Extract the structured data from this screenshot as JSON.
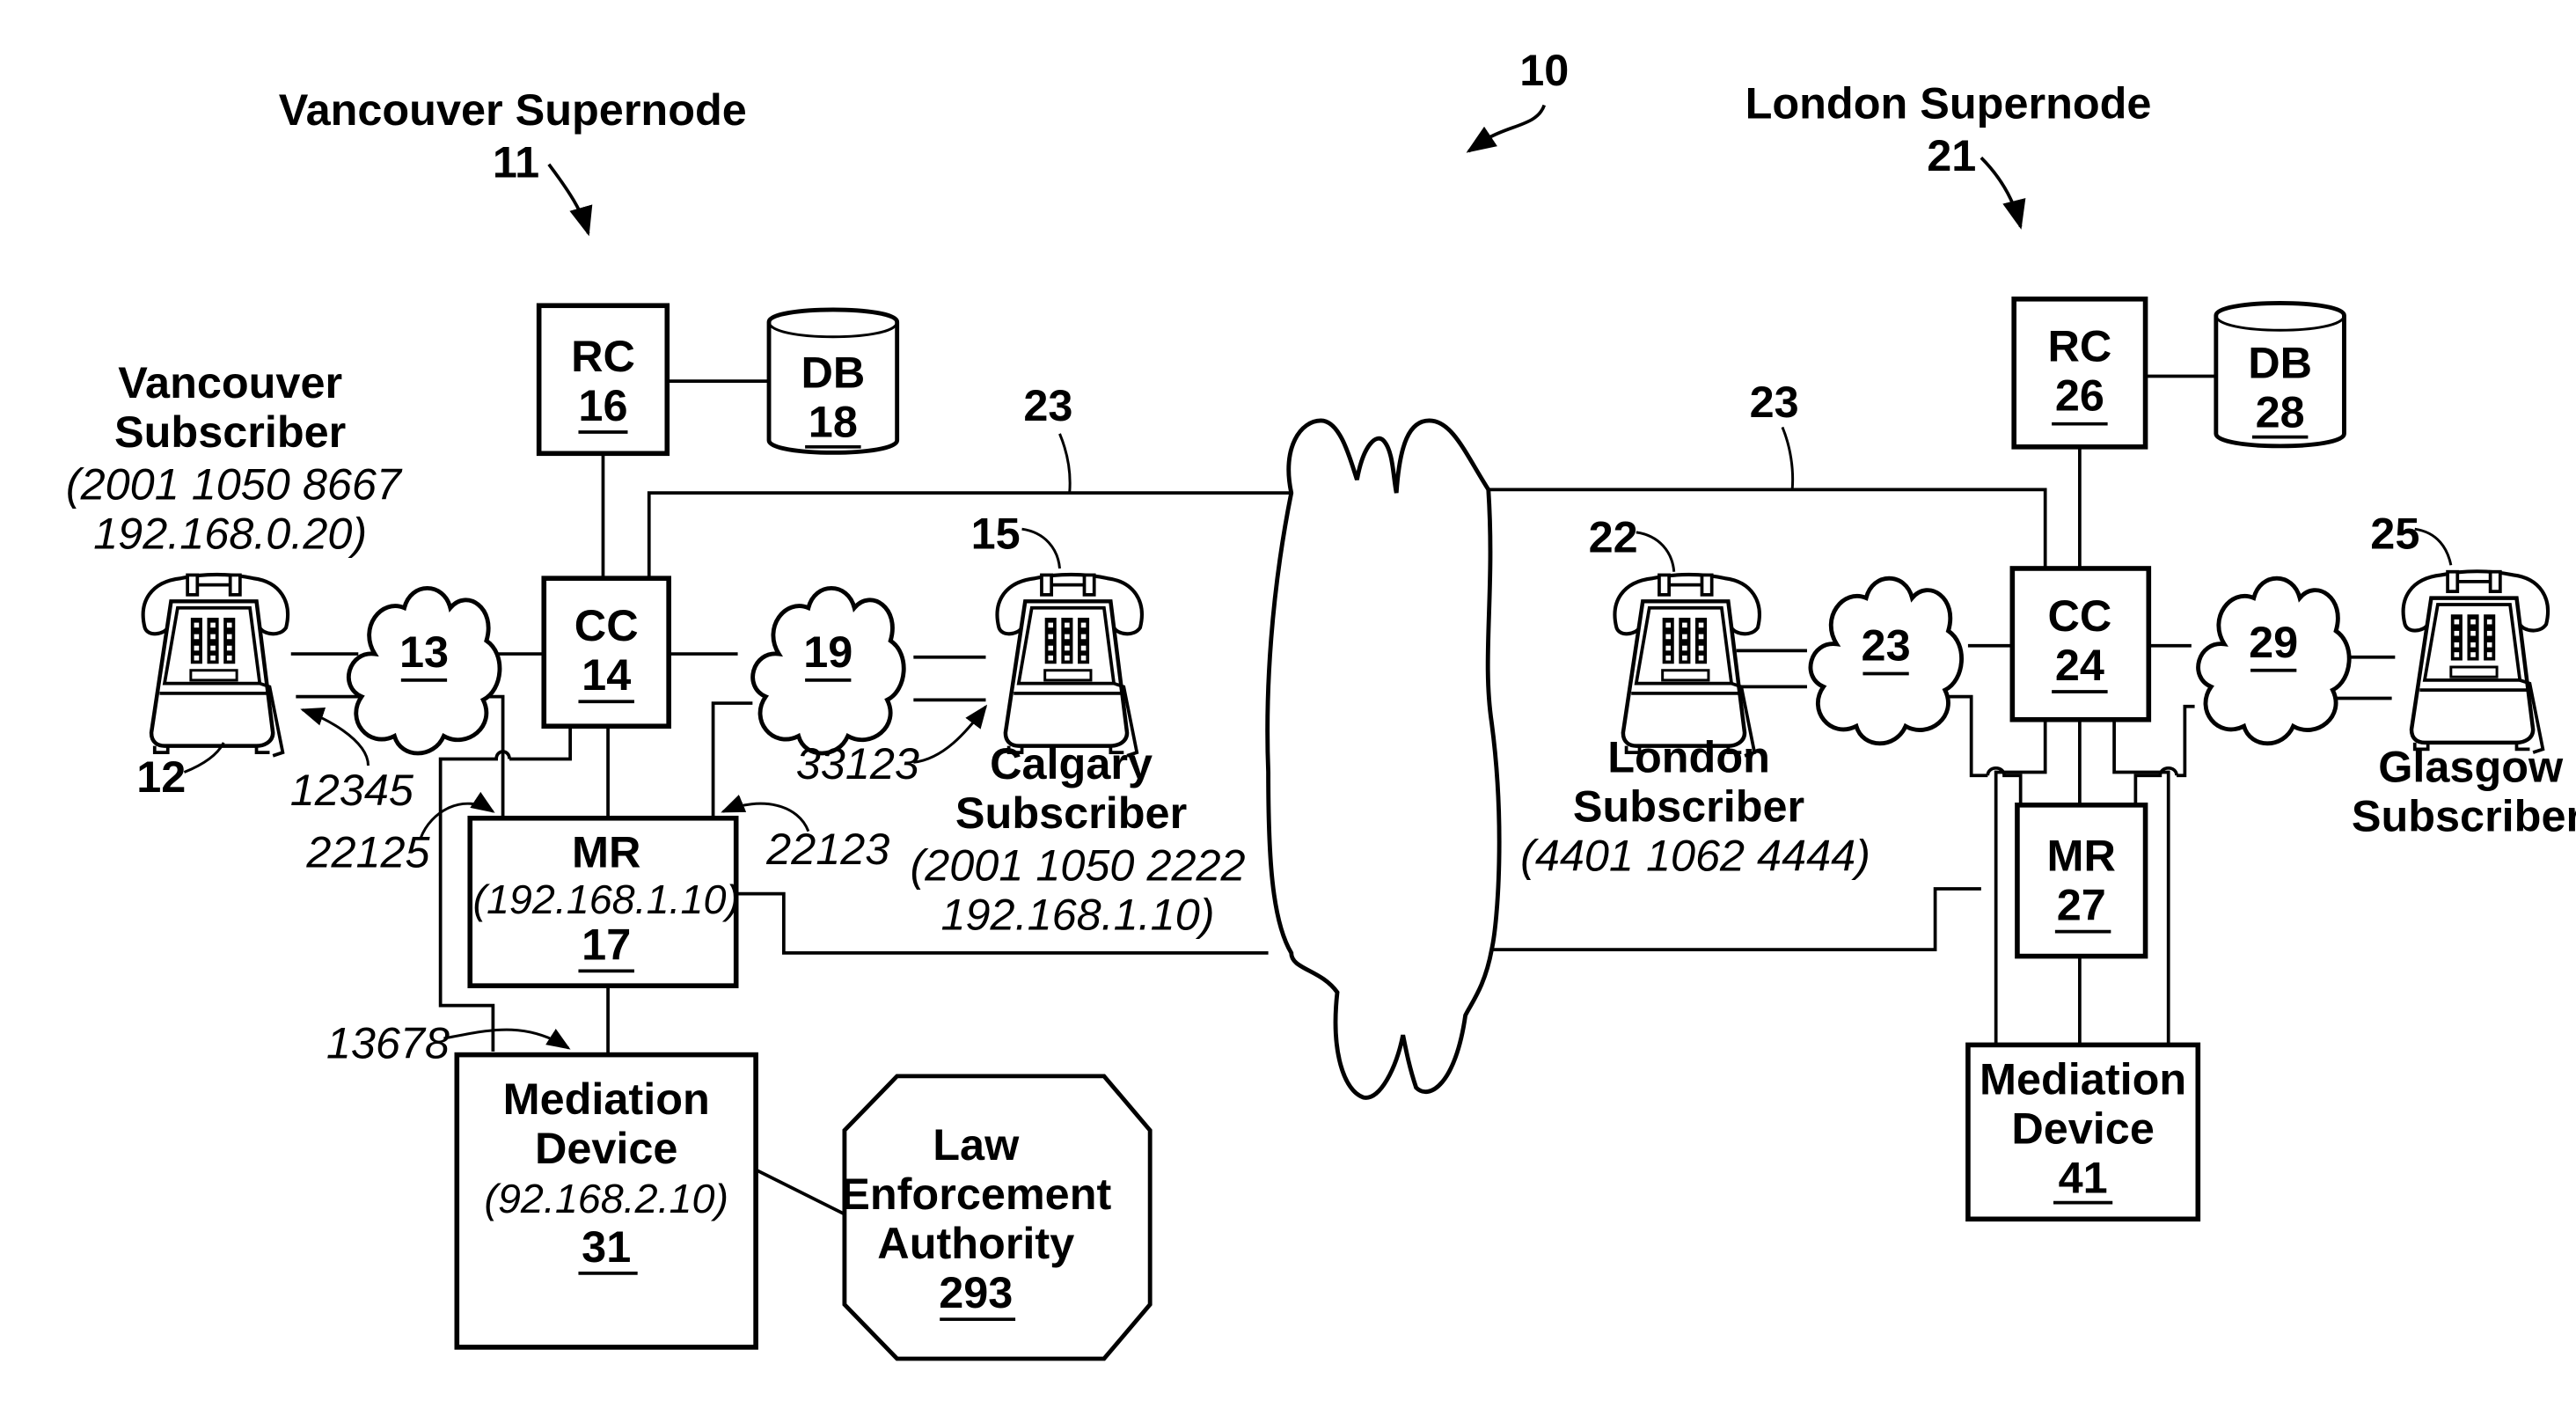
{
  "figure": {
    "ref": "10",
    "ink_color": "#000000",
    "background": "#ffffff"
  },
  "supernodes": {
    "vancouver": {
      "title": "Vancouver Supernode",
      "ref": "11"
    },
    "london": {
      "title": "London Supernode",
      "ref": "21"
    }
  },
  "nodes": {
    "rc16": {
      "name": "RC",
      "ref": "16"
    },
    "db18": {
      "name": "DB",
      "ref": "18"
    },
    "cc14": {
      "name": "CC",
      "ref": "14"
    },
    "mr17": {
      "name": "MR",
      "address": "(192.168.1.10)",
      "ref": "17"
    },
    "md31": {
      "name_line1": "Mediation",
      "name_line2": "Device",
      "address": "(92.168.2.10)",
      "ref": "31"
    },
    "lea293": {
      "line1": "Law",
      "line2": "Enforcement",
      "line3": "Authority",
      "ref": "293"
    },
    "rc26": {
      "name": "RC",
      "ref": "26"
    },
    "db28": {
      "name": "DB",
      "ref": "28"
    },
    "cc24": {
      "name": "CC",
      "ref": "24"
    },
    "mr27": {
      "name": "MR",
      "ref": "27"
    },
    "md41": {
      "name_line1": "Mediation",
      "name_line2": "Device",
      "ref": "41"
    }
  },
  "clouds": {
    "c13": "13",
    "c19": "19",
    "c23": "23",
    "c29": "29"
  },
  "subscribers": {
    "vancouver": {
      "line1": "Vancouver",
      "line2": "Subscriber",
      "number": "(2001 1050 8667",
      "ip": "192.168.0.20)",
      "ref": "12"
    },
    "calgary": {
      "line1": "Calgary",
      "line2": "Subscriber",
      "number": "(2001 1050 2222",
      "ip": "192.168.1.10)",
      "ref": "15"
    },
    "london": {
      "line1": "London",
      "line2": "Subscriber",
      "number": "(4401 1062 4444)",
      "ref": "22"
    },
    "glasgow": {
      "line1": "Glasgow",
      "line2": "Subscriber",
      "ref": "25"
    }
  },
  "link_labels": {
    "link_left": "23",
    "link_right": "23",
    "port_12345": "12345",
    "port_22125": "22125",
    "port_22123": "22123",
    "port_33123": "33123",
    "port_13678": "13678"
  }
}
